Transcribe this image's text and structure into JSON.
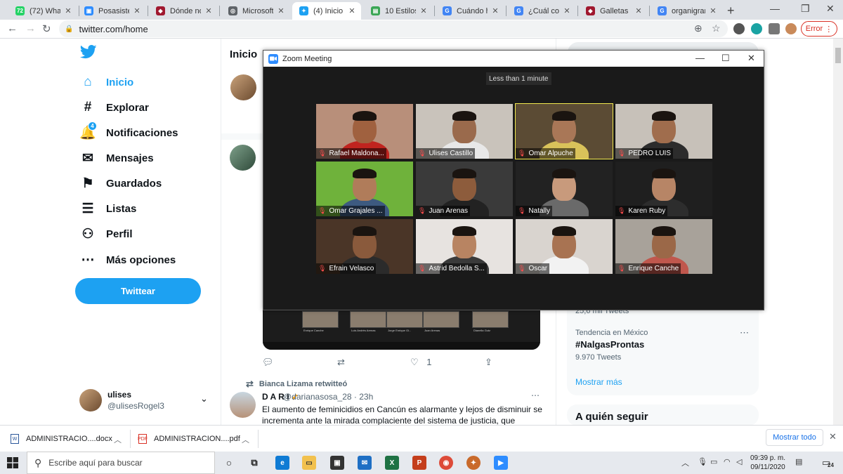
{
  "browser": {
    "tabs": [
      {
        "title": "(72) WhatsApp",
        "color": "#25d366",
        "glyph": "72"
      },
      {
        "title": "Posasistente",
        "color": "#2d8cff",
        "glyph": "▣"
      },
      {
        "title": "Dónde noticias",
        "color": "#a0182f",
        "glyph": "◆"
      },
      {
        "title": "Microsoft Word",
        "color": "#5f6368",
        "glyph": "◎"
      },
      {
        "title": "(4) Inicio / Twitter",
        "color": "#1da1f2",
        "glyph": "✦"
      },
      {
        "title": "10 Estilos de",
        "color": "#3aa655",
        "glyph": "▤"
      },
      {
        "title": "Cuándo hay",
        "color": "#4285f4",
        "glyph": "G"
      },
      {
        "title": "¿Cuál consid",
        "color": "#4285f4",
        "glyph": "G"
      },
      {
        "title": "Galletas Don",
        "color": "#a0182f",
        "glyph": "◆"
      },
      {
        "title": "organigrama",
        "color": "#4285f4",
        "glyph": "G"
      }
    ],
    "url": "twitter.com/home",
    "error_label": "Error"
  },
  "twitter": {
    "nav": [
      {
        "label": "Inicio",
        "icon": "home-icon",
        "glyph": "⌂"
      },
      {
        "label": "Explorar",
        "icon": "hash-icon",
        "glyph": "#"
      },
      {
        "label": "Notificaciones",
        "icon": "bell-icon",
        "glyph": "🔔"
      },
      {
        "label": "Mensajes",
        "icon": "mail-icon",
        "glyph": "✉"
      },
      {
        "label": "Guardados",
        "icon": "bookmark-icon",
        "glyph": "⚑"
      },
      {
        "label": "Listas",
        "icon": "list-icon",
        "glyph": "☰"
      },
      {
        "label": "Perfil",
        "icon": "person-icon",
        "glyph": "⚇"
      },
      {
        "label": "Más opciones",
        "icon": "more-icon",
        "glyph": "⋯"
      }
    ],
    "notif_count": "4",
    "tweet_button": "Twittear",
    "profile": {
      "name": "ulises",
      "handle": "@ulisesRogel3"
    },
    "main_title": "Inicio",
    "tweet_actions": {
      "likes": "1"
    },
    "retweet": {
      "note": "Bianca Lizama retwitteó",
      "name": "D A R I",
      "handle": "@darianasosa_28 · 23h",
      "text": "El aumento de feminicidios en Cancún es alarmante y lejos de disminuir se incrementa ante la mirada complaciente del sistema de justicia, que"
    },
    "mini_labels": [
      "Enrique Canche",
      "Luis Andrés Arenas",
      "Jorge Enrique Gl...",
      "Juan Arenas",
      "Dianella Gutz"
    ],
    "trends": {
      "partial_count": "25,6 mil Tweets",
      "location": "Tendencia en México",
      "name": "#NalgasProntas",
      "count": "9.970 Tweets",
      "show_more": "Mostrar más"
    },
    "who_to_follow": "A quién seguir"
  },
  "zoom": {
    "title": "Zoom Meeting",
    "timer": "Less than 1 minute",
    "participants": [
      {
        "name": "Rafael Maldona...",
        "bg": "#b88f7a",
        "skin": "#a0613f",
        "shirt": "#c0241f",
        "speaking": false
      },
      {
        "name": "Ulises Castillo",
        "bg": "#c9c3bb",
        "skin": "#9a6a4c",
        "shirt": "#e8e8e8",
        "speaking": false
      },
      {
        "name": "Omar Alpuche",
        "bg": "#5b4b34",
        "skin": "#a97757",
        "shirt": "#d9c25a",
        "speaking": true
      },
      {
        "name": "PEDRO LUIS",
        "bg": "#c7c1b9",
        "skin": "#a06d4d",
        "shirt": "#2c2c2c",
        "speaking": false
      },
      {
        "name": "Omar Grajales ...",
        "bg": "#6fb23b",
        "skin": "#b07c5a",
        "shirt": "#3d5a80",
        "speaking": false
      },
      {
        "name": "Juan Arenas",
        "bg": "#3a3a3a",
        "skin": "#8d5c3c",
        "shirt": "#222222",
        "speaking": false
      },
      {
        "name": "Natally",
        "bg": "#222222",
        "skin": "#c89a7c",
        "shirt": "#6a6a6a",
        "speaking": false
      },
      {
        "name": "Karen Ruby",
        "bg": "#1f1f1f",
        "skin": "#b78566",
        "shirt": "#2d2d2d",
        "speaking": false
      },
      {
        "name": "Efrain Velasco",
        "bg": "#4a3527",
        "skin": "#8a5a3c",
        "shirt": "#2b2b2b",
        "speaking": false
      },
      {
        "name": "Astrid Bedolla S...",
        "bg": "#e7e3e0",
        "skin": "#b88462",
        "shirt": "#3a3a3a",
        "speaking": false
      },
      {
        "name": "Oscar",
        "bg": "#d9d4cf",
        "skin": "#a87352",
        "shirt": "#f2f2f2",
        "speaking": false
      },
      {
        "name": "Enrique Canche",
        "bg": "#a8a29a",
        "skin": "#9b6848",
        "shirt": "#c0574d",
        "speaking": false
      }
    ]
  },
  "downloads": {
    "items": [
      {
        "name": "ADMINISTRACIO....docx",
        "type": "W"
      },
      {
        "name": "ADMINISTRACION....pdf",
        "type": "PDF"
      }
    ],
    "show_all": "Mostrar todo"
  },
  "taskbar": {
    "search_placeholder": "Escribe aquí para buscar",
    "time": "09:39 p. m.",
    "date": "09/11/2020",
    "notif_count": "24"
  }
}
